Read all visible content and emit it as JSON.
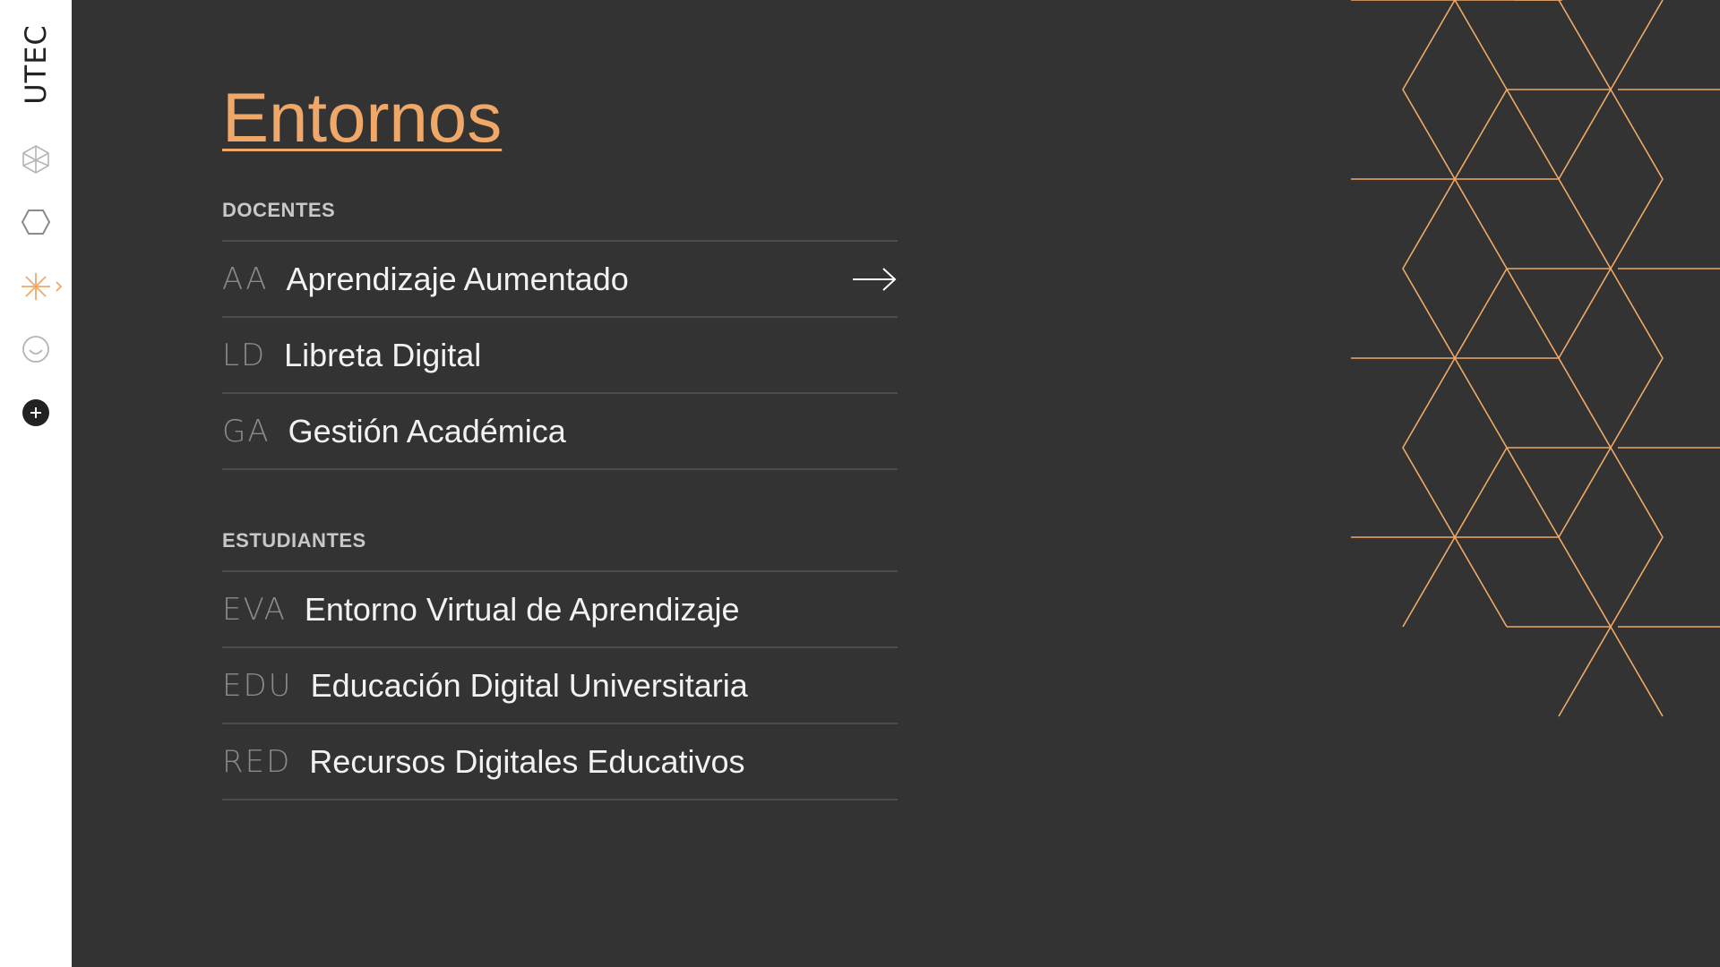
{
  "sidebar": {
    "logo": "UTEC",
    "items": [
      {
        "name": "cube-icon"
      },
      {
        "name": "hexagon-icon"
      },
      {
        "name": "asterisk-icon",
        "active": true
      },
      {
        "name": "smiley-icon"
      },
      {
        "name": "add-icon"
      }
    ]
  },
  "main": {
    "title": "Entornos",
    "sections": [
      {
        "label": "DOCENTES",
        "items": [
          {
            "code": "AA",
            "label": "Aprendizaje Aumentado"
          },
          {
            "code": "LD",
            "label": "Libreta Digital"
          },
          {
            "code": "GA",
            "label": "Gestión Académica"
          }
        ]
      },
      {
        "label": "ESTUDIANTES",
        "items": [
          {
            "code": "EVA",
            "label": "Entorno Virtual de Aprendizaje"
          },
          {
            "code": "EDU",
            "label": "Educación Digital Universitaria"
          },
          {
            "code": "RED",
            "label": "Recursos Digitales Educativos"
          }
        ]
      }
    ]
  },
  "colors": {
    "accent": "#f0a868",
    "background": "#333333",
    "sidebar": "#ffffff"
  }
}
